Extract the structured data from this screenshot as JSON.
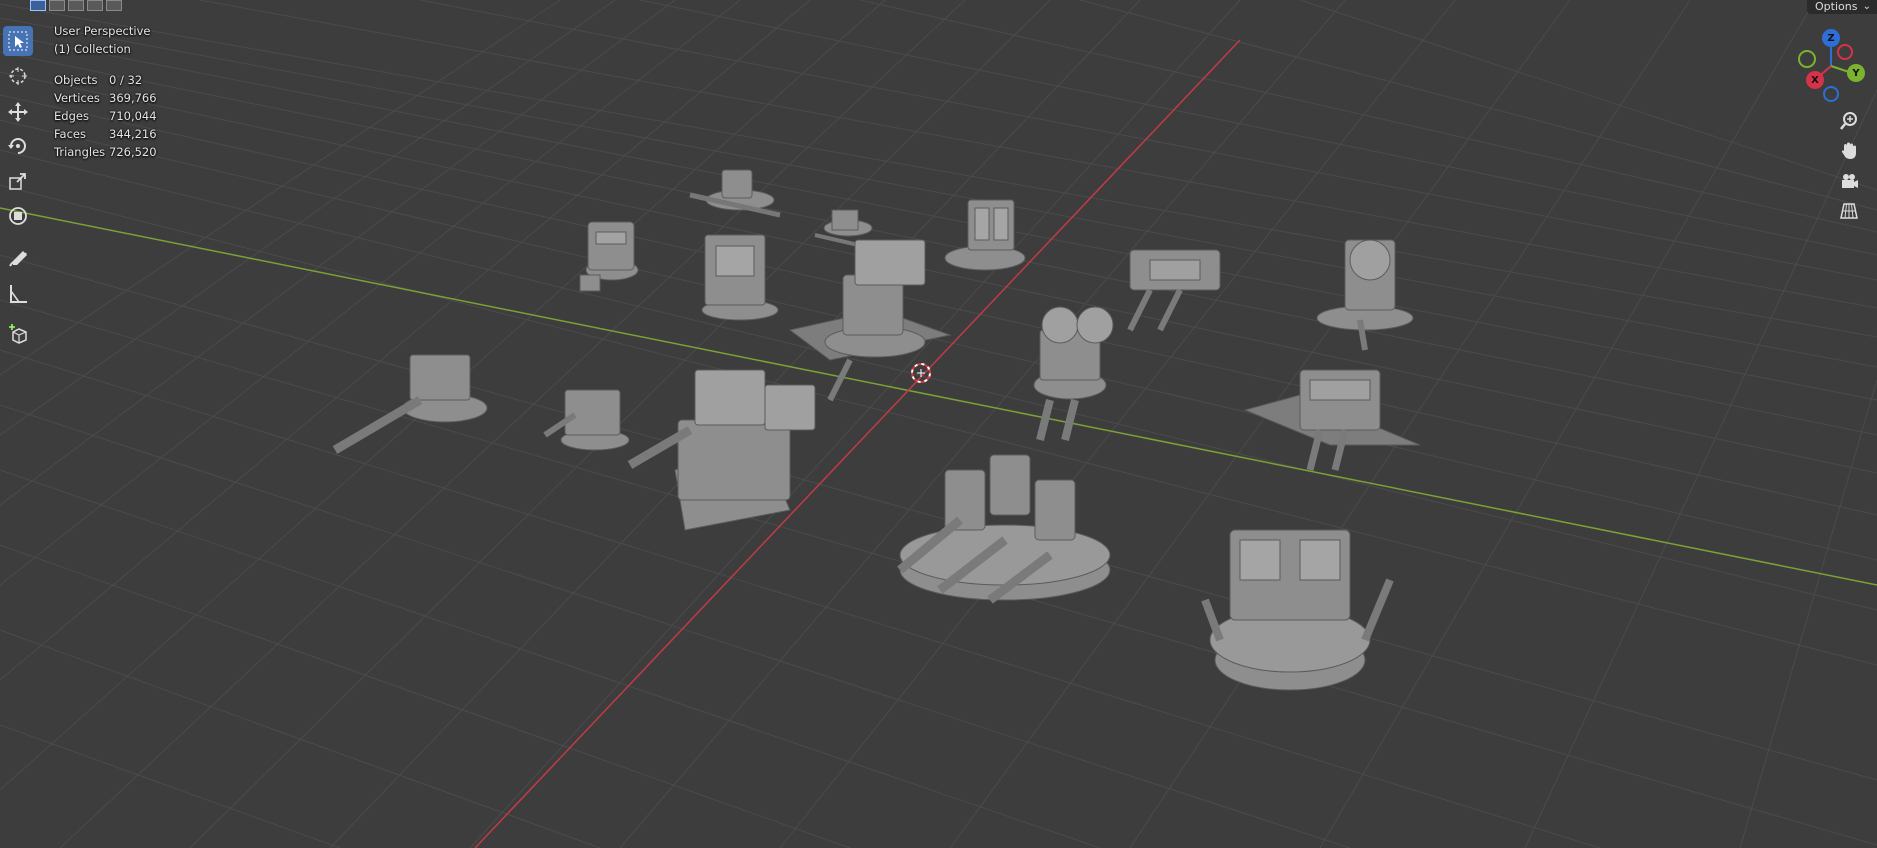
{
  "overlay": {
    "view_name": "User Perspective",
    "collection": "(1) Collection",
    "stats": [
      {
        "label": "Objects",
        "value": "0 / 32"
      },
      {
        "label": "Vertices",
        "value": "369,766"
      },
      {
        "label": "Edges",
        "value": "710,044"
      },
      {
        "label": "Faces",
        "value": "344,216"
      },
      {
        "label": "Triangles",
        "value": "726,520"
      }
    ]
  },
  "header": {
    "options_label": "Options"
  },
  "gizmo": {
    "z_label": "Z",
    "y_label": "Y",
    "x_label": "X"
  },
  "toolbar": {
    "tools": [
      "select-box",
      "cursor",
      "move",
      "rotate",
      "scale",
      "transform",
      "annotate",
      "measure",
      "add-cube"
    ],
    "active_tool": "select-box"
  },
  "colors": {
    "background": "#3d3d3d",
    "grid_line": "#4a4a4a",
    "x_axis": "#c23a48",
    "y_axis": "#7aa236",
    "gizmo_z": "#2d6fd6",
    "gizmo_y": "#7bb32e",
    "gizmo_x": "#d5334a",
    "accent": "#4772b3"
  }
}
